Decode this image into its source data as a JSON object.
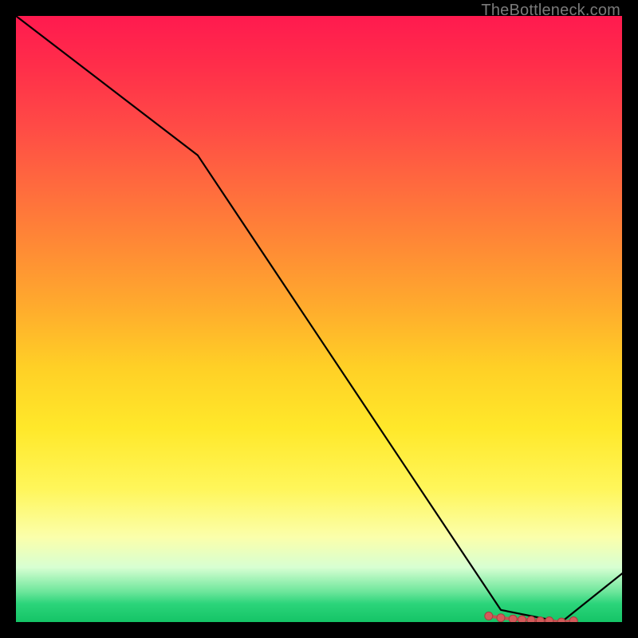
{
  "attribution": "TheBottleneck.com",
  "chart_data": {
    "type": "line",
    "title": "",
    "xlabel": "",
    "ylabel": "",
    "xlim": [
      0,
      100
    ],
    "ylim": [
      0,
      100
    ],
    "series": [
      {
        "name": "bottleneck-curve",
        "x": [
          0,
          30,
          80,
          90,
          100
        ],
        "values": [
          100,
          77,
          2,
          0,
          8
        ]
      }
    ],
    "marker_cluster": {
      "name": "optimal-points",
      "x": [
        78,
        80,
        82,
        83.5,
        85,
        86.5,
        88,
        90,
        92
      ],
      "values": [
        1.0,
        0.7,
        0.5,
        0.4,
        0.3,
        0.2,
        0.2,
        0.0,
        0.2
      ]
    },
    "gradient_top_color": "#ff1a4f",
    "gradient_bottom_color": "#15c466"
  }
}
